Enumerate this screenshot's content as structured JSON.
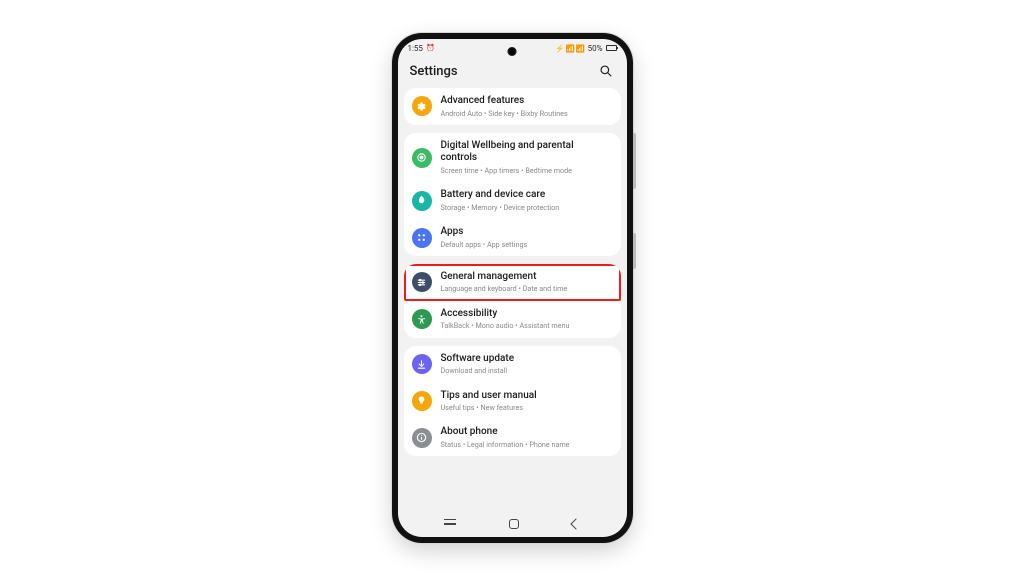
{
  "status": {
    "time": "1:55",
    "ampm_hint": "",
    "battery_pct": "50%"
  },
  "header": {
    "title": "Settings"
  },
  "groups": [
    {
      "rows": [
        {
          "icon": "advanced-features-icon",
          "color": "c-orange",
          "title": "Advanced features",
          "sub": "Android Auto  •  Side key  •  Bixby Routines",
          "highlight": false
        }
      ]
    },
    {
      "rows": [
        {
          "icon": "wellbeing-icon",
          "color": "c-green",
          "title": "Digital Wellbeing and parental controls",
          "sub": "Screen time  •  App timers  •  Bedtime mode",
          "highlight": false
        },
        {
          "icon": "battery-care-icon",
          "color": "c-teal",
          "title": "Battery and device care",
          "sub": "Storage  •  Memory  •  Device protection",
          "highlight": false
        },
        {
          "icon": "apps-icon",
          "color": "c-blue",
          "title": "Apps",
          "sub": "Default apps  •  App settings",
          "highlight": false
        }
      ]
    },
    {
      "rows": [
        {
          "icon": "general-management-icon",
          "color": "c-indigo",
          "title": "General management",
          "sub": "Language and keyboard  •  Date and time",
          "highlight": true
        },
        {
          "icon": "accessibility-icon",
          "color": "c-green2",
          "title": "Accessibility",
          "sub": "TalkBack  •  Mono audio  •  Assistant menu",
          "highlight": false
        }
      ]
    },
    {
      "rows": [
        {
          "icon": "software-update-icon",
          "color": "c-purple",
          "title": "Software update",
          "sub": "Download and install",
          "highlight": false
        },
        {
          "icon": "tips-icon",
          "color": "c-amber",
          "title": "Tips and user manual",
          "sub": "Useful tips  •  New features",
          "highlight": false
        },
        {
          "icon": "about-phone-icon",
          "color": "c-grey",
          "title": "About phone",
          "sub": "Status  •  Legal information  •  Phone name",
          "highlight": false
        }
      ]
    }
  ]
}
